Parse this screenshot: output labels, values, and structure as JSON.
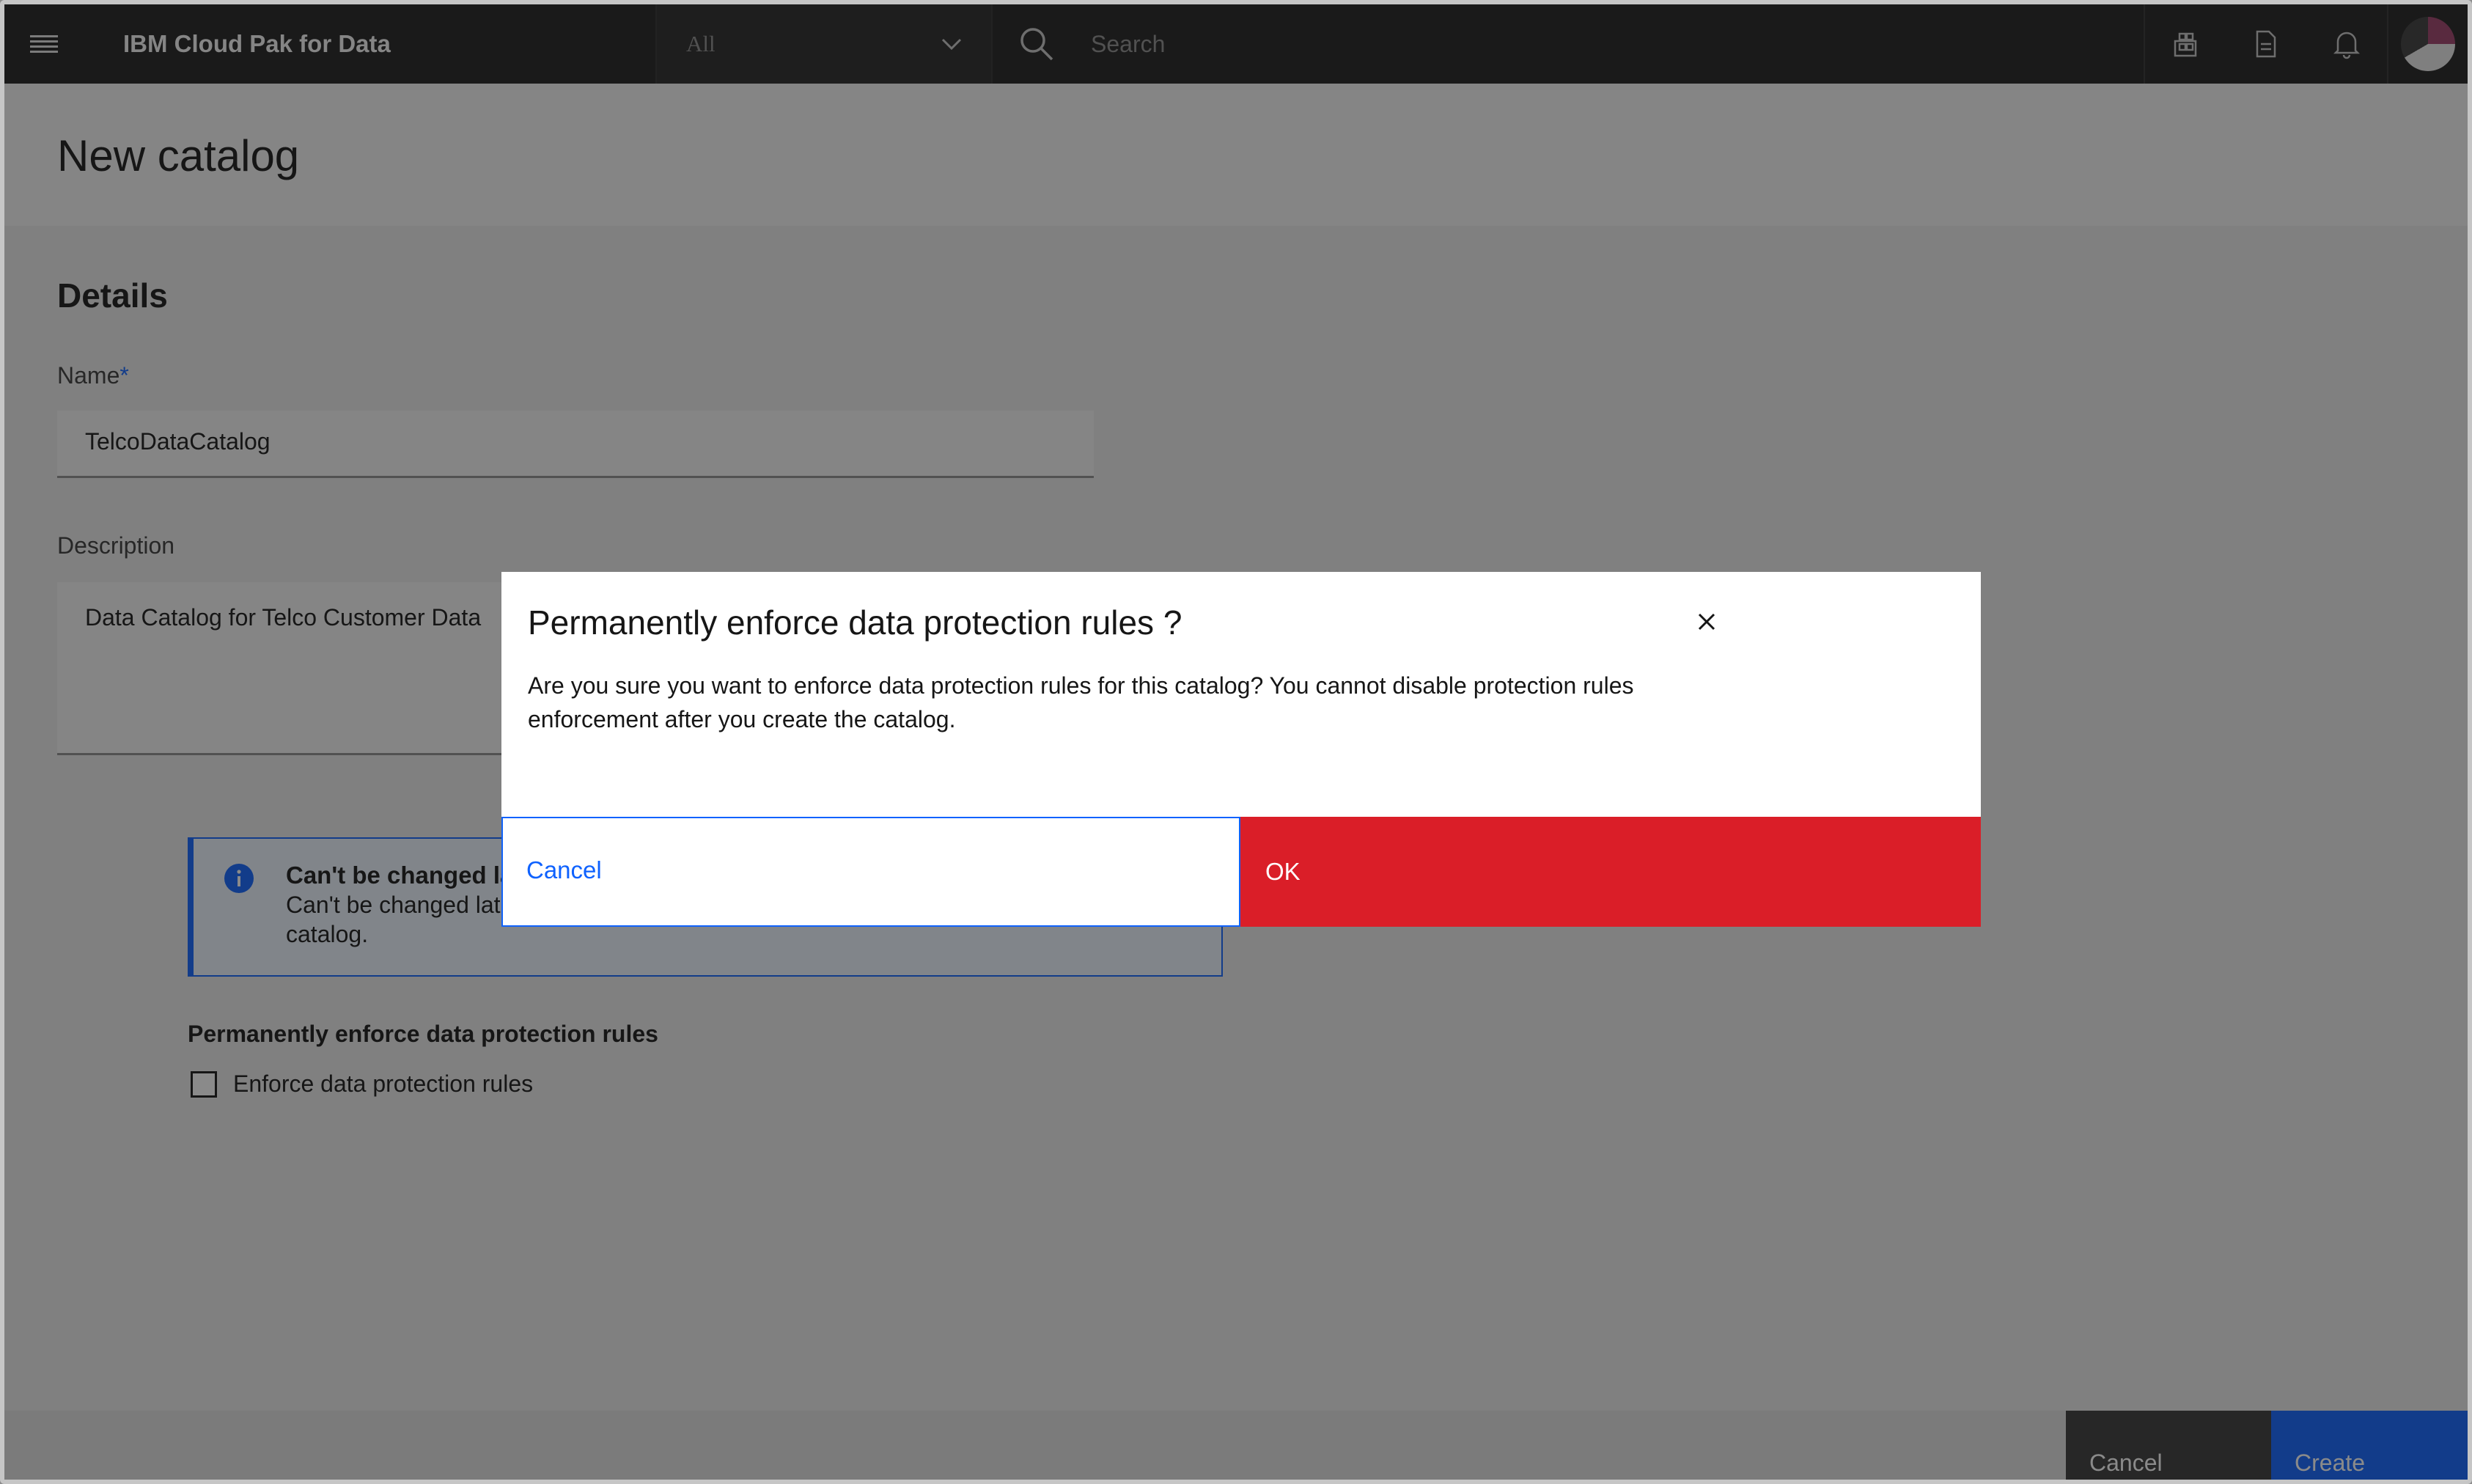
{
  "header": {
    "brand": "IBM Cloud Pak for Data",
    "scope_selected": "All",
    "search_placeholder": "Search",
    "icons": [
      "hamburger-menu-icon",
      "chevron-down-icon",
      "search-icon",
      "apps-icon",
      "document-icon",
      "notification-bell-icon",
      "avatar"
    ]
  },
  "page": {
    "title": "New catalog",
    "details": {
      "section_title": "Details",
      "name_label": "Name",
      "name_required_mark": "*",
      "name_value": "TelcoDataCatalog",
      "description_label": "Description",
      "description_value": "Data Catalog for Telco Customer Data"
    },
    "notification": {
      "title": "Can't be changed la",
      "body": "Can't be changed lat",
      "body_line2": "catalog."
    },
    "enforce": {
      "title": "Permanently enforce data protection rules",
      "checkbox_label": "Enforce data protection rules",
      "checked": false
    }
  },
  "footer": {
    "cancel_label": "Cancel",
    "create_label": "Create"
  },
  "modal": {
    "heading": "Permanently enforce data protection rules ?",
    "body": "Are you sure you want to enforce data protection rules for this catalog? You cannot disable protection rules enforcement after you create the catalog.",
    "cancel_label": "Cancel",
    "ok_label": "OK"
  },
  "colors": {
    "primary": "#0f62fe",
    "danger": "#da1e28",
    "topbar": "#1f1f1f"
  }
}
